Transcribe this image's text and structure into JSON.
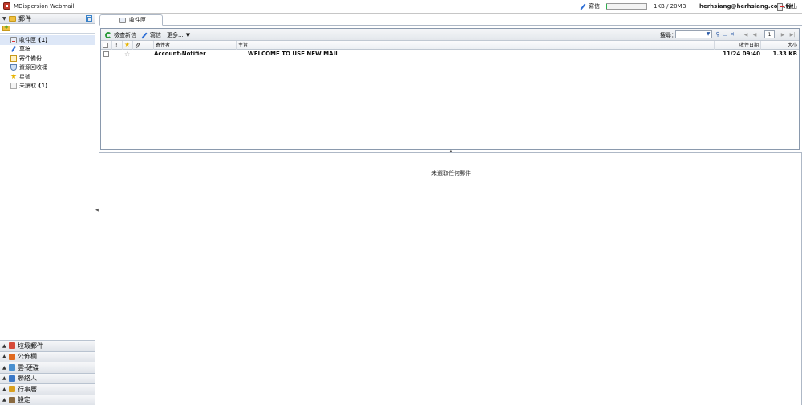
{
  "app": {
    "title": "MDispersion Webmail"
  },
  "topbar": {
    "compose_label": "寫信",
    "quota_percent": 1,
    "quota_text": "1KB / 20MB",
    "user_email": "herhsiang@herhsiang.com.tw",
    "logout_label": "登出"
  },
  "sidebar": {
    "mail_header": "郵件",
    "folders": [
      {
        "label": "收件匣",
        "count": "(1)"
      },
      {
        "label": "草稿"
      },
      {
        "label": "寄件備份"
      },
      {
        "label": "資源回收桶"
      },
      {
        "label": "星號"
      },
      {
        "label": "未讀取",
        "count": "(1)"
      }
    ],
    "bottom_sections": [
      {
        "label": "垃圾郵件",
        "color": "#d64a3a"
      },
      {
        "label": "公佈欄",
        "color": "#e06a20"
      },
      {
        "label": "雲-硬碟",
        "color": "#4a90d0"
      },
      {
        "label": "聯絡人",
        "color": "#3a78c8"
      },
      {
        "label": "行事曆",
        "color": "#d9a020"
      },
      {
        "label": "設定",
        "color": "#8a6a40"
      }
    ]
  },
  "main": {
    "tab_label": "收件匣",
    "toolbar": {
      "refresh_label": "檢查新信",
      "compose_label": "寫信",
      "more_label": "更多..."
    },
    "search": {
      "label": "搜尋：",
      "value": ""
    },
    "pager": {
      "page": "1"
    },
    "columns": {
      "priority": "!",
      "sender": "寄件者",
      "subject": "主旨",
      "date": "收件日期",
      "size": "大小"
    },
    "rows": [
      {
        "sender": "Account-Notifier",
        "subject": "WELCOME TO USE NEW MAIL",
        "date": "11/24 09:40",
        "size": "1.33 KB"
      }
    ]
  },
  "preview": {
    "empty_message": "未選取任何郵件"
  },
  "colors": {
    "accent": "#3a82c8",
    "quota_fill": "#2bb24c",
    "selected_row": "#dde7f7"
  }
}
